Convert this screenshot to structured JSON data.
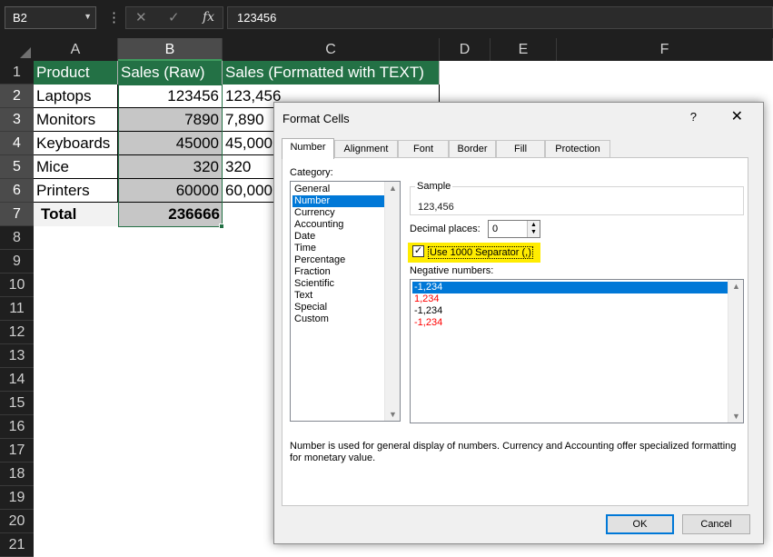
{
  "formula_bar": {
    "name_box": "B2",
    "cancel_glyph": "✕",
    "enter_glyph": "✓",
    "fx_label": "fx",
    "value": "123456"
  },
  "columns": [
    "A",
    "B",
    "C",
    "D",
    "E",
    "F"
  ],
  "rows": [
    "1",
    "2",
    "3",
    "4",
    "5",
    "6",
    "7",
    "8",
    "9",
    "10",
    "11",
    "12",
    "13",
    "14",
    "15",
    "16",
    "17",
    "18",
    "19",
    "20",
    "21"
  ],
  "sheet": {
    "headers": [
      "Product",
      "Sales (Raw)",
      "Sales (Formatted with TEXT)"
    ],
    "data": [
      {
        "product": "Laptops",
        "raw": "123456",
        "formatted": "123,456"
      },
      {
        "product": "Monitors",
        "raw": "7890",
        "formatted": "7,890"
      },
      {
        "product": "Keyboards",
        "raw": "45000",
        "formatted": "45,000"
      },
      {
        "product": "Mice",
        "raw": "320",
        "formatted": "320"
      },
      {
        "product": "Printers",
        "raw": "60000",
        "formatted": "60,000"
      }
    ],
    "total_label": "Total",
    "total_value": "236666"
  },
  "colors": {
    "header_green": "#237145",
    "selection_gray": "#c6c6c6",
    "dialog_highlight": "#ffec00",
    "list_selected": "#0078d7",
    "negative_red": "#ff0000"
  },
  "dialog": {
    "title": "Format Cells",
    "help": "?",
    "close": "✕",
    "tabs": [
      "Number",
      "Alignment",
      "Font",
      "Border",
      "Fill",
      "Protection"
    ],
    "category_label": "Category:",
    "categories": [
      "General",
      "Number",
      "Currency",
      "Accounting",
      "Date",
      "Time",
      "Percentage",
      "Fraction",
      "Scientific",
      "Text",
      "Special",
      "Custom"
    ],
    "selected_category": "Number",
    "sample_label": "Sample",
    "sample_value": "123,456",
    "decimal_label": "Decimal places:",
    "decimal_value": "0",
    "separator_checked": true,
    "separator_label": "Use 1000 Separator (,)",
    "negative_label": "Negative numbers:",
    "negative_options": [
      {
        "text": "-1,234",
        "red": false,
        "selected": true
      },
      {
        "text": "1,234",
        "red": true,
        "selected": false
      },
      {
        "text": "-1,234",
        "red": false,
        "selected": false
      },
      {
        "text": "-1,234",
        "red": true,
        "selected": false
      }
    ],
    "description": "Number is used for general display of numbers.  Currency and Accounting offer specialized formatting for monetary value.",
    "ok": "OK",
    "cancel": "Cancel"
  }
}
